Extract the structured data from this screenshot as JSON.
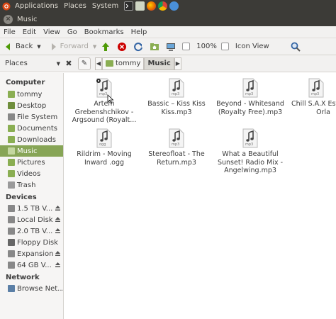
{
  "top_panel": {
    "menus": [
      "Applications",
      "Places",
      "System"
    ]
  },
  "window": {
    "title": "Music"
  },
  "menubar": {
    "items": [
      "File",
      "Edit",
      "View",
      "Go",
      "Bookmarks",
      "Help"
    ]
  },
  "toolbar": {
    "back_label": "Back",
    "forward_label": "Forward",
    "zoom_label": "100%",
    "view_label": "Icon View"
  },
  "location": {
    "places_label": "Places",
    "crumbs": [
      "tommy",
      "Music"
    ]
  },
  "sidebar": {
    "sections": [
      {
        "heading": "Computer",
        "items": [
          "tommy",
          "Desktop",
          "File System",
          "Documents",
          "Downloads",
          "Music",
          "Pictures",
          "Videos",
          "Trash"
        ]
      },
      {
        "heading": "Devices",
        "items": [
          "1.5 TB V...",
          "Local Disk",
          "2.0 TB V...",
          "Floppy Disk",
          "Expansion",
          "64 GB V..."
        ]
      },
      {
        "heading": "Network",
        "items": [
          "Browse Net..."
        ]
      }
    ],
    "selected": "Music"
  },
  "files": [
    {
      "name": "Artem Grebenshchikov - Argsound (Royalt...",
      "badge": "mp3"
    },
    {
      "name": "Bassic – Kiss Kiss Kiss.mp3",
      "badge": "mp3"
    },
    {
      "name": "Beyond - Whitesand (Royalty Free).mp3",
      "badge": "mp3"
    },
    {
      "name": "Chill S.A.X Esteban Orla",
      "badge": "mp3"
    },
    {
      "name": "Rildrim - Moving Inward .ogg",
      "badge": "ogg"
    },
    {
      "name": "Stereofloat - The Return.mp3",
      "badge": "mp3"
    },
    {
      "name": "What a Beautiful Sunset! Radio Mix - Angelwing.mp3",
      "badge": "mp3"
    }
  ],
  "colors": {
    "panel_bg": "#3c3b37",
    "selection": "#87a556",
    "window_bg": "#f2f1f0"
  }
}
